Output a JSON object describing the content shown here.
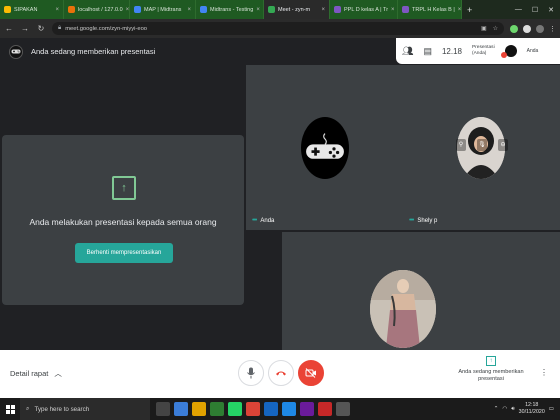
{
  "browser": {
    "tabs": [
      {
        "label": "SIPAKAN",
        "color": "#fbbc04"
      },
      {
        "label": "localhost / 127.0.0",
        "color": "#e8710a"
      },
      {
        "label": "MAP | Midtrans",
        "color": "#4285f4"
      },
      {
        "label": "Midtrans - Testing",
        "color": "#4285f4"
      },
      {
        "label": "Meet - zyn-m",
        "color": "#34a853",
        "active": true
      },
      {
        "label": "PPL D kelas A | Tr",
        "color": "#7e57c2"
      },
      {
        "label": "TRPL H Kelas B |",
        "color": "#7e57c2"
      }
    ],
    "new_tab": "+",
    "url": "meet.google.com/zyn-miyyi-eoo"
  },
  "meet": {
    "header_title": "Anda sedang memberikan presentasi",
    "time": "12.18",
    "presentation_chip_line1": "Presentasi",
    "presentation_chip_line2": "(Anda)",
    "you_label": "Anda",
    "presenting_text": "Anda melakukan presentasi kepada semua orang",
    "stop_button": "Berhenti mempresentasikan",
    "participants": [
      {
        "name": "Anda"
      },
      {
        "name": "Shely p"
      },
      {
        "name": ""
      }
    ]
  },
  "controls": {
    "detail_label": "Detail rapat",
    "present_label_line1": "Anda sedang memberikan",
    "present_label_line2": "presentasi"
  },
  "taskbar": {
    "search_placeholder": "Type here to search",
    "time": "12:18",
    "date": "30/11/2020"
  },
  "colors": {
    "accent": "#26a69a",
    "danger": "#ea4335"
  }
}
